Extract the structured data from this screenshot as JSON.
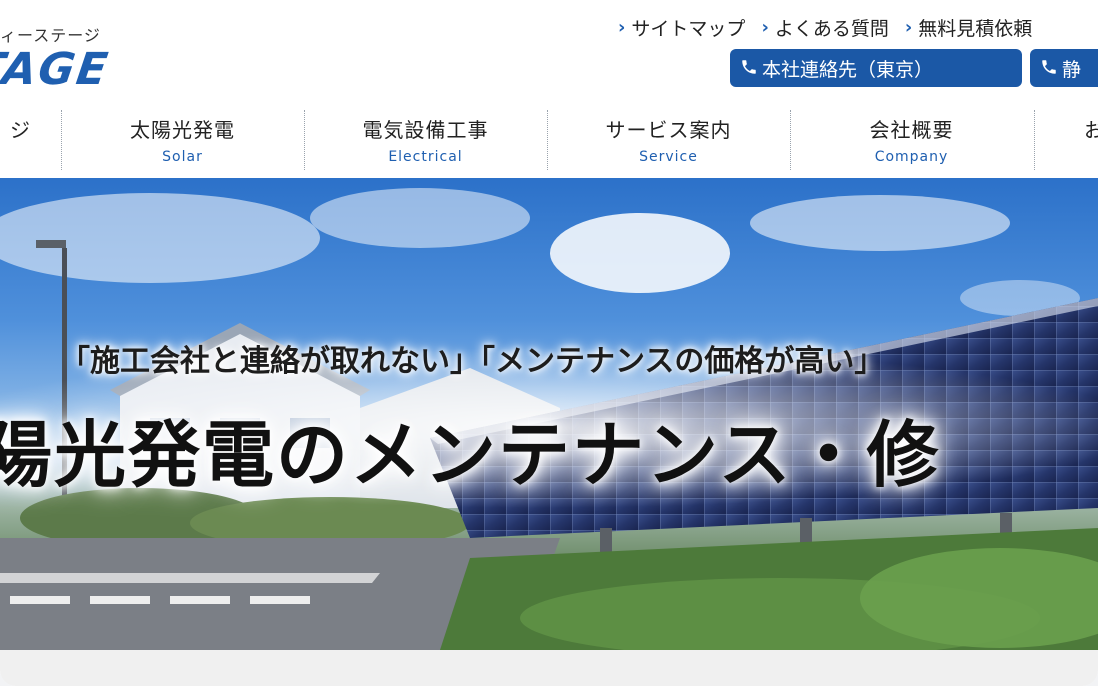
{
  "header": {
    "logo_sub": "ィーステージ",
    "logo_main": "TAGE"
  },
  "util_links": [
    "サイトマップ",
    "よくある質問",
    "無料見積依頼"
  ],
  "contact_buttons": [
    {
      "label": "本社連絡先（東京）"
    },
    {
      "label": "静"
    }
  ],
  "nav": [
    {
      "jp": "ジ",
      "en": ""
    },
    {
      "jp": "太陽光発電",
      "en": "Solar"
    },
    {
      "jp": "電気設備工事",
      "en": "Electrical"
    },
    {
      "jp": "サービス案内",
      "en": "Service"
    },
    {
      "jp": "会社概要",
      "en": "Company"
    },
    {
      "jp": "お",
      "en": ""
    }
  ],
  "hero": {
    "catch": "「施工会社と連絡が取れない」「メンテナンスの価格が高い」",
    "headline": "陽光発電のメンテナンス・修"
  },
  "icons": {
    "phone": "phone-icon",
    "chevron": "chevron-right-icon"
  },
  "colors": {
    "brand_blue": "#1b58a6",
    "accent_blue": "#1f5fb0"
  }
}
